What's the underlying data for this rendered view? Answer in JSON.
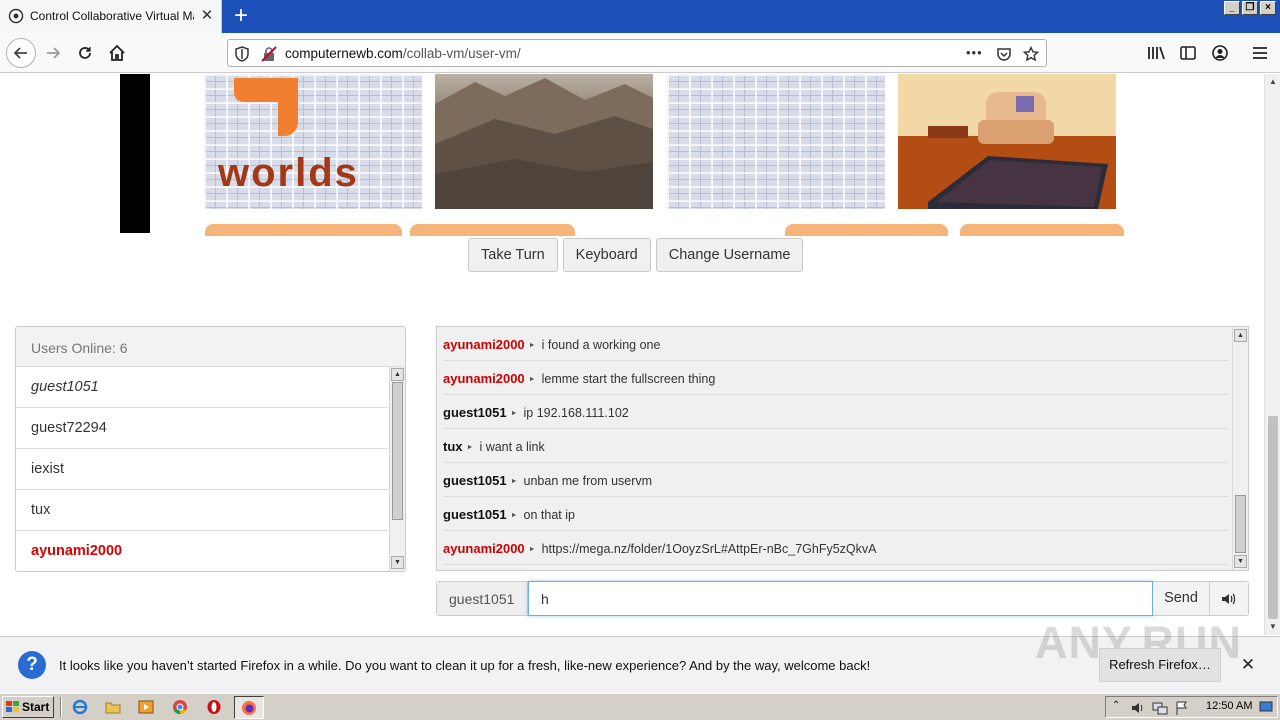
{
  "browser": {
    "tab_title": "Control Collaborative Virtual Machine",
    "url_host": "computernewb.com",
    "url_path": "/collab-vm/user-vm/",
    "menu_dots": "•••"
  },
  "vm_controls": {
    "take_turn": "Take Turn",
    "keyboard": "Keyboard",
    "change_username": "Change Username"
  },
  "thumb1_logo_text": "worlds",
  "users": {
    "header": "Users Online: 6",
    "items": [
      {
        "name": "guest1051",
        "style": "me"
      },
      {
        "name": "guest72294",
        "style": ""
      },
      {
        "name": "iexist",
        "style": ""
      },
      {
        "name": "tux",
        "style": ""
      },
      {
        "name": "ayunami2000",
        "style": "admin"
      }
    ]
  },
  "chat": {
    "messages": [
      {
        "user": "ayunami2000",
        "admin": true,
        "text": "i found a working one"
      },
      {
        "user": "ayunami2000",
        "admin": true,
        "text": "lemme start the fullscreen thing"
      },
      {
        "user": "guest1051",
        "admin": false,
        "text": "ip 192.168.111.102"
      },
      {
        "user": "tux",
        "admin": false,
        "text": "i want a link"
      },
      {
        "user": "guest1051",
        "admin": false,
        "text": "unban me from uservm"
      },
      {
        "user": "guest1051",
        "admin": false,
        "text": "on that ip"
      },
      {
        "user": "ayunami2000",
        "admin": true,
        "text": "https://mega.nz/folder/1OoyzSrL#AttpEr-nBc_7GhFy5zQkvA"
      }
    ],
    "nick": "guest1051",
    "input_value": "h",
    "send_label": "Send"
  },
  "notification": {
    "text": "It looks like you haven’t started Firefox in a while. Do you want to clean it up for a fresh, like-new experience? And by the way, welcome back!",
    "button": "Refresh Firefox…",
    "watermark": "ANY.RUN"
  },
  "taskbar": {
    "start": "Start",
    "clock": "12:50 AM"
  },
  "colors": {
    "admin_red": "#cc0000",
    "titlebar_blue": "#1c4fb7"
  }
}
